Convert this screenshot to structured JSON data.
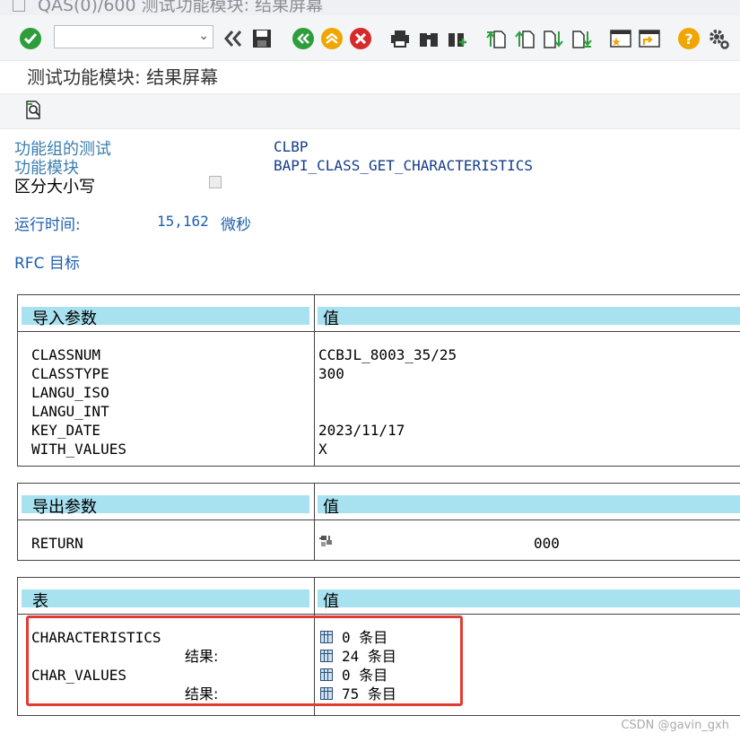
{
  "window": {
    "title": "QAS(0)/600 测试功能模块: 结果屏幕"
  },
  "toolbar": {
    "command_field_value": "",
    "icons": [
      "enter-icon",
      "back-double-icon",
      "save-icon",
      "back-icon",
      "exit-icon",
      "cancel-icon",
      "print-icon",
      "find-icon",
      "find-next-icon",
      "first-page-icon",
      "previous-page-icon",
      "next-page-icon",
      "last-page-icon",
      "create-session-icon",
      "generate-shortcut-icon",
      "help-icon",
      "settings-icon"
    ]
  },
  "screen": {
    "title": "测试功能模块: 结果屏幕"
  },
  "header": {
    "fg_label": "功能组的测试",
    "fg_value": "CLBP",
    "fm_label": "功能模块",
    "fm_value": "BAPI_CLASS_GET_CHARACTERISTICS",
    "case_label": "区分大小写",
    "runtime_label": "运行时间:",
    "runtime_value": "15,162",
    "runtime_unit": "微秒",
    "rfc_label": "RFC 目标"
  },
  "import": {
    "header_name": "导入参数",
    "header_value": "值",
    "rows": [
      {
        "name": "CLASSNUM",
        "value": "CCBJL_8003_35/25"
      },
      {
        "name": "CLASSTYPE",
        "value": "300"
      },
      {
        "name": "LANGU_ISO",
        "value": ""
      },
      {
        "name": "LANGU_INT",
        "value": ""
      },
      {
        "name": "KEY_DATE",
        "value": "2023/11/17"
      },
      {
        "name": "WITH_VALUES",
        "value": "X"
      }
    ]
  },
  "export": {
    "header_name": "导出参数",
    "header_value": "值",
    "rows": [
      {
        "name": "RETURN",
        "value": "000",
        "icon": "structure-icon"
      }
    ]
  },
  "tables": {
    "header_name": "表",
    "header_value": "值",
    "rows": [
      {
        "name": "CHARACTERISTICS",
        "value": "0 条目"
      },
      {
        "name": "结果:",
        "value": "24 条目"
      },
      {
        "name": "CHAR_VALUES",
        "value": "0 条目"
      },
      {
        "name": "结果:",
        "value": "75 条目"
      }
    ]
  },
  "watermark": "CSDN @gavin_gxh",
  "colors": {
    "header_bg": "#a8e2f0",
    "label_blue": "#3b7fb0",
    "value_blue": "#143c8a",
    "highlight_red": "#e23b32"
  }
}
